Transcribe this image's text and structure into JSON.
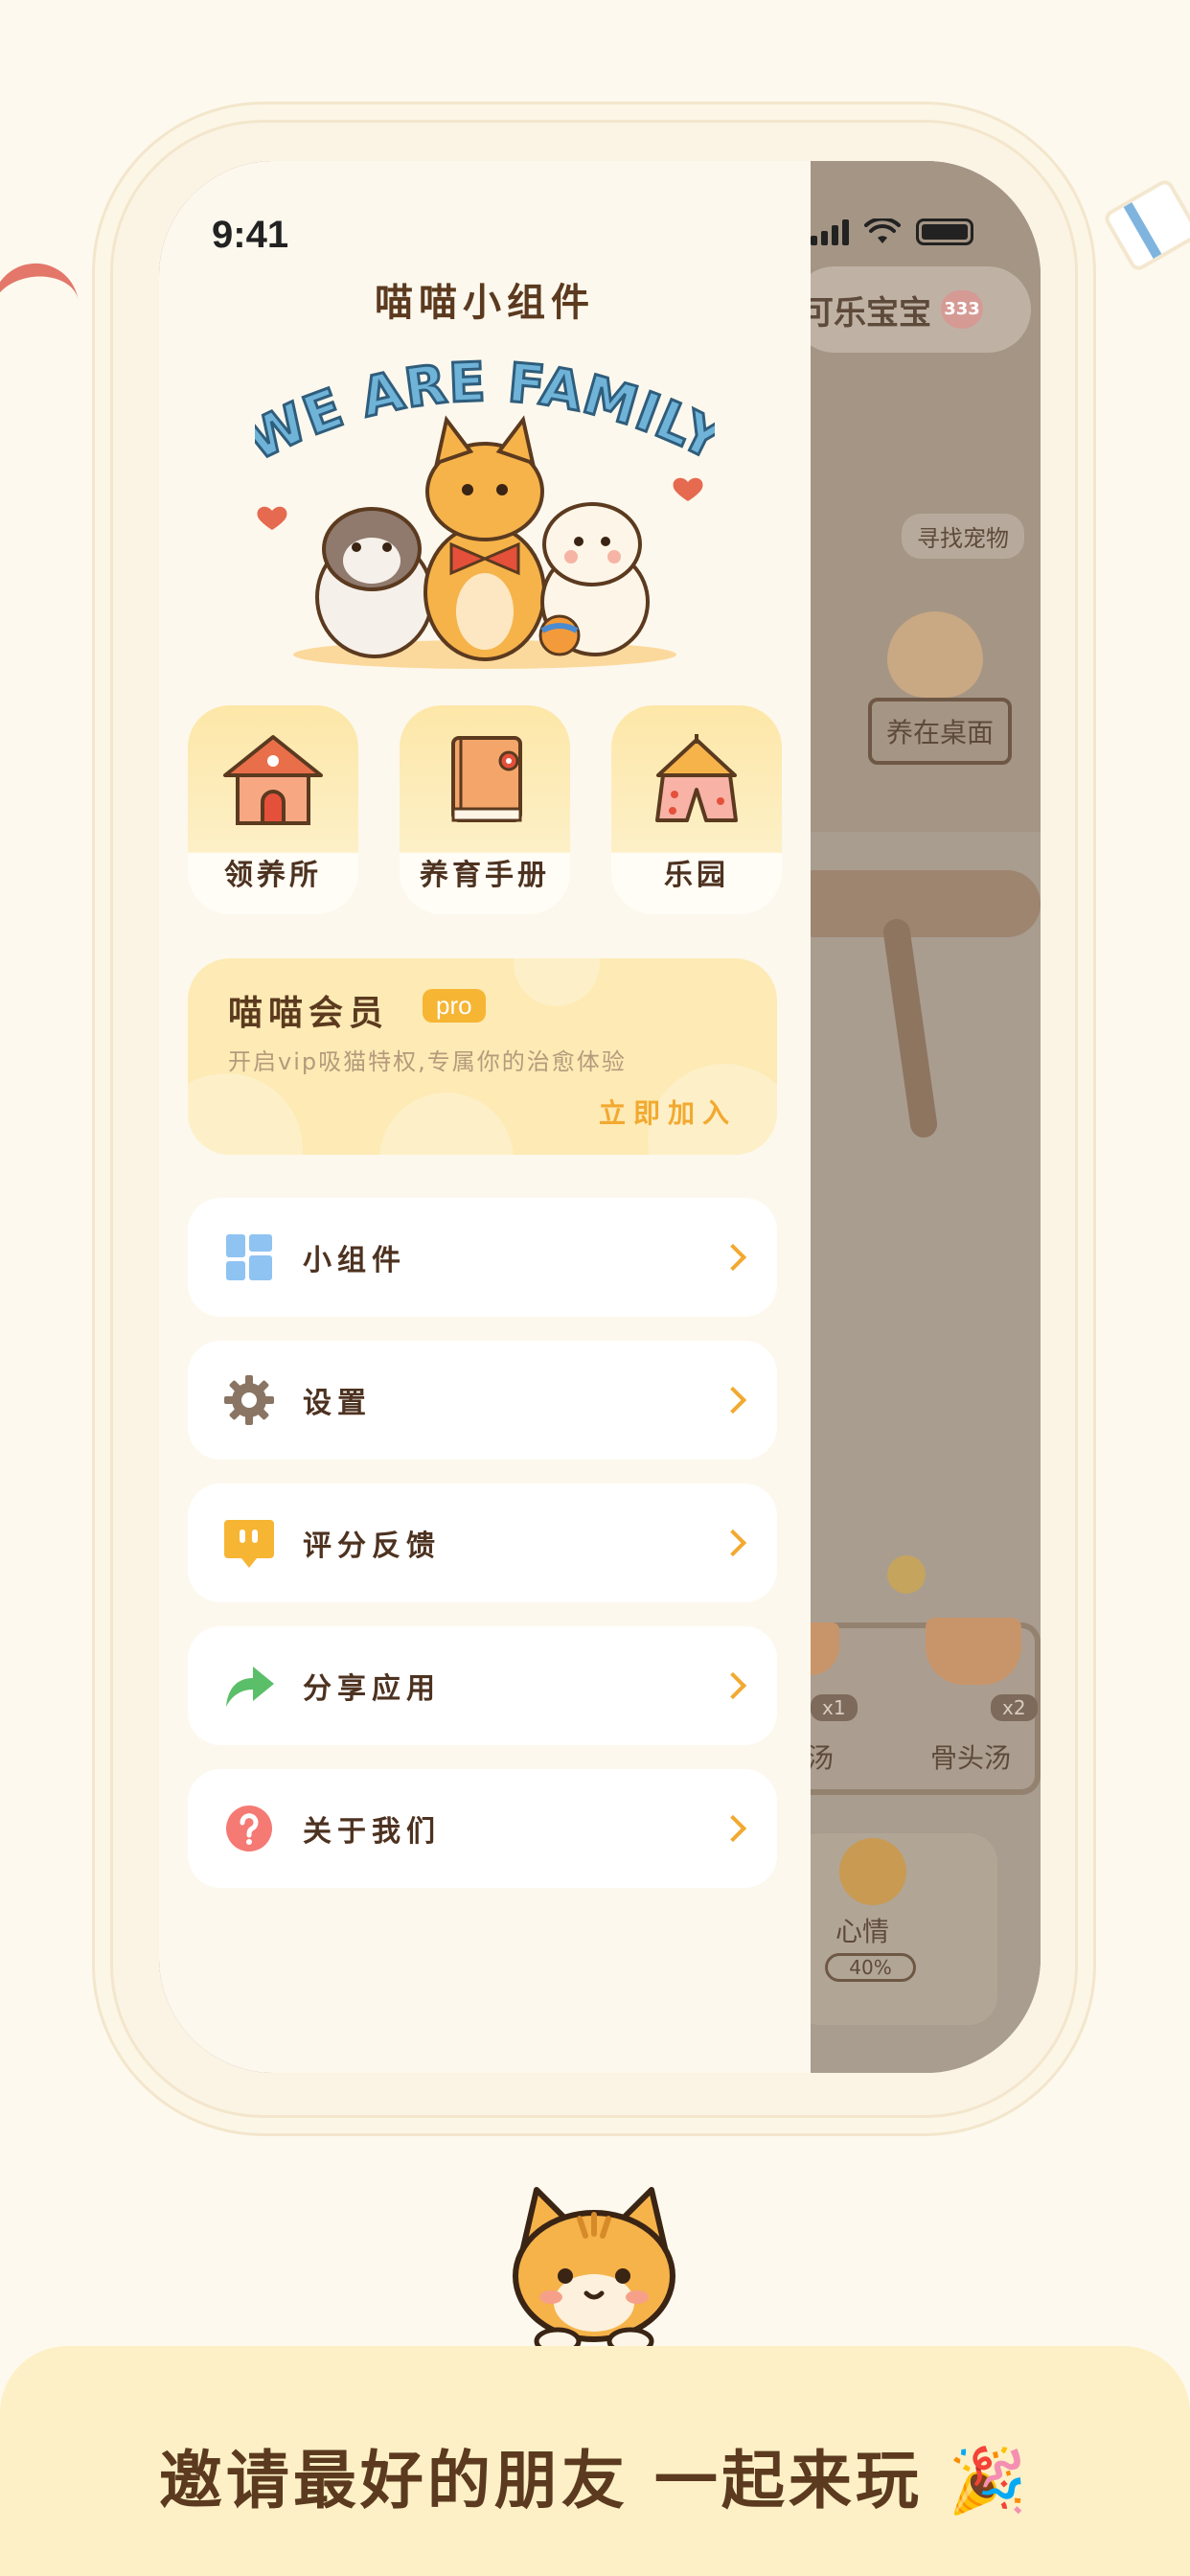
{
  "status_bar": {
    "time": "9:41"
  },
  "app": {
    "title": "喵喵小组件",
    "hero_banner": "WE ARE FAMILY"
  },
  "features": [
    {
      "label": "领养所",
      "icon": "house-icon"
    },
    {
      "label": "养育手册",
      "icon": "book-icon"
    },
    {
      "label": "乐园",
      "icon": "tent-icon"
    }
  ],
  "vip": {
    "title": "喵喵会员",
    "badge": "pro",
    "subtitle": "开启vip吸猫特权,专属你的治愈体验",
    "join": "立即加入"
  },
  "menu": [
    {
      "label": "小组件",
      "icon": "widget-grid-icon"
    },
    {
      "label": "设置",
      "icon": "gear-icon"
    },
    {
      "label": "评分反馈",
      "icon": "feedback-icon"
    },
    {
      "label": "分享应用",
      "icon": "share-arrow-icon"
    },
    {
      "label": "关于我们",
      "icon": "question-icon"
    }
  ],
  "background_app": {
    "name_pill": "可乐宝宝",
    "heart_value": "333",
    "search_label": "寻找宠物",
    "desktop_sign": "养在桌面",
    "item_1_count": "x1",
    "item_2_count": "x2",
    "item_1_label": "汤",
    "item_2_label": "骨头汤",
    "mood_label": "心情",
    "mood_percent": "40%"
  },
  "footer": {
    "slogan": "邀请最好的朋友 一起来玩",
    "emoji": "🎉"
  },
  "colors": {
    "accent": "#f2a930",
    "badge": "#f6b533",
    "text_brown": "#5b3a1f",
    "card_yellow": "#fdeab4",
    "background": "#fdf9ee"
  }
}
